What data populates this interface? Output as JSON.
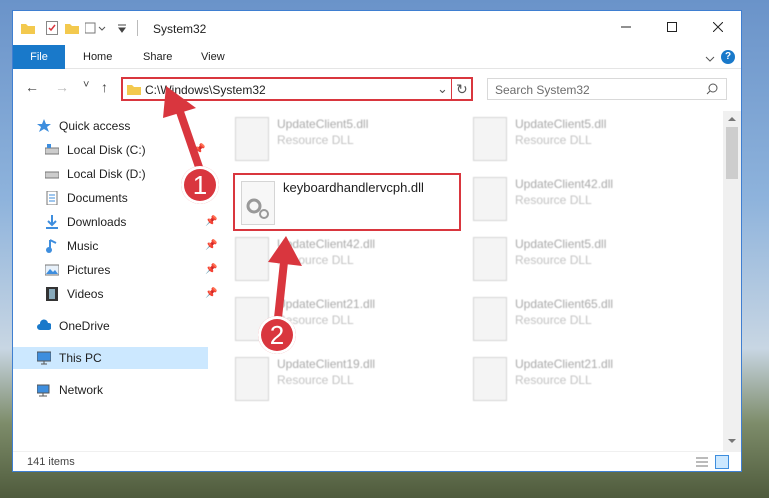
{
  "window": {
    "title": "System32"
  },
  "ribbon": {
    "file": "File",
    "home": "Home",
    "share": "Share",
    "view": "View",
    "help": "?"
  },
  "nav_buttons": {
    "back": "←",
    "forward": "→",
    "recent": "˅",
    "up": "↑"
  },
  "address": {
    "path": "C:\\Windows\\System32",
    "dropdown": "⌄",
    "refresh": "↻"
  },
  "search": {
    "placeholder": "Search System32"
  },
  "sidebar": {
    "quick_access": "Quick access",
    "local_c": "Local Disk (C:)",
    "local_d": "Local Disk (D:)",
    "documents": "Documents",
    "downloads": "Downloads",
    "music": "Music",
    "pictures": "Pictures",
    "videos": "Videos",
    "onedrive": "OneDrive",
    "thispc": "This PC",
    "network": "Network"
  },
  "files_left": [
    {
      "name": "UpdateClient5.dll",
      "type": "Resource DLL"
    },
    {
      "name": "UpdateClient42.dll",
      "type": "Resource DLL"
    },
    {
      "name": "UpdateClient21.dll",
      "type": "Resource DLL"
    },
    {
      "name": "UpdateClient19.dll",
      "type": "Resource DLL"
    }
  ],
  "files_right": [
    {
      "name": "UpdateClient5.dll",
      "type": "Resource DLL"
    },
    {
      "name": "UpdateClient42.dll",
      "type": "Resource DLL"
    },
    {
      "name": "UpdateClient5.dll",
      "type": "Resource DLL"
    },
    {
      "name": "UpdateClient65.dll",
      "type": "Resource DLL"
    },
    {
      "name": "UpdateClient21.dll",
      "type": "Resource DLL"
    }
  ],
  "highlighted_file": {
    "name": "keyboardhandlervcph.dll"
  },
  "status": {
    "items": "141 items"
  },
  "annotations": {
    "step1": "1",
    "step2": "2"
  },
  "colors": {
    "accent": "#1979ca",
    "highlight": "#d9363e"
  }
}
